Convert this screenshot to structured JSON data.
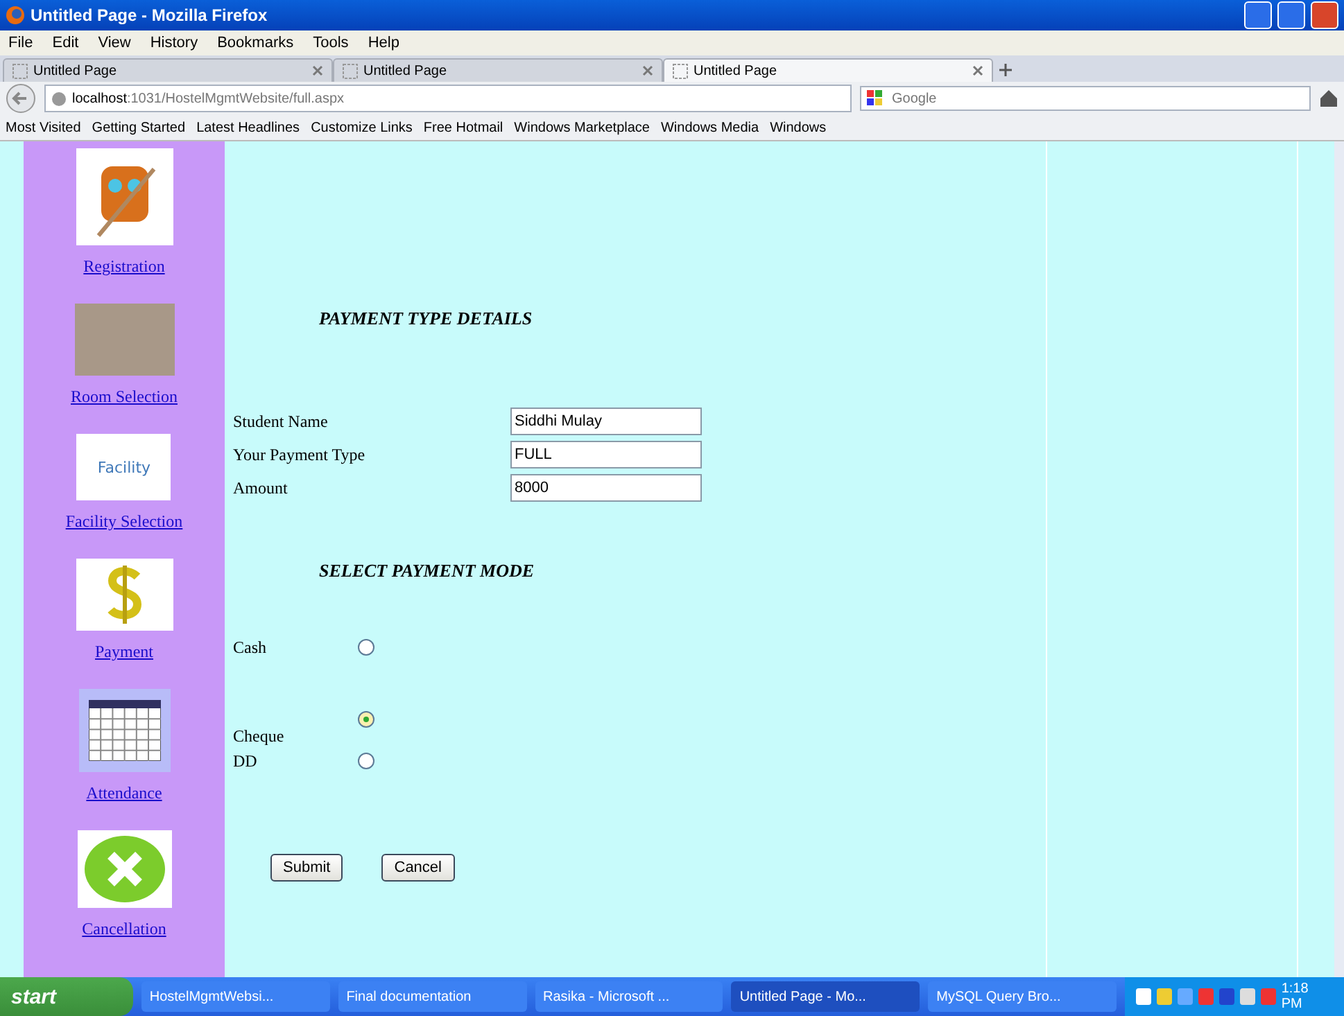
{
  "window": {
    "title": "Untitled Page - Mozilla Firefox"
  },
  "menu": [
    "File",
    "Edit",
    "View",
    "History",
    "Bookmarks",
    "Tools",
    "Help"
  ],
  "tabs": [
    {
      "label": "Untitled Page",
      "selected": false
    },
    {
      "label": "Untitled Page",
      "selected": false
    },
    {
      "label": "Untitled Page",
      "selected": true
    }
  ],
  "address": {
    "host": "localhost",
    "path": ":1031/HostelMgmtWebsite/full.aspx"
  },
  "search": {
    "placeholder": "Google"
  },
  "bookmarks": [
    "Most Visited",
    "Getting Started",
    "Latest Headlines",
    "Customize Links",
    "Free Hotmail",
    "Windows Marketplace",
    "Windows Media",
    "Windows"
  ],
  "sidebar": {
    "items": [
      {
        "label": "Registration",
        "kind": "owl"
      },
      {
        "label": "Room Selection",
        "kind": "photo"
      },
      {
        "label": "Facility Selection",
        "kind": "logo",
        "logo_text": "Facility"
      },
      {
        "label": "Payment",
        "kind": "dollar"
      },
      {
        "label": "Attendance",
        "kind": "calendar"
      },
      {
        "label": "Cancellation",
        "kind": "cancel"
      }
    ]
  },
  "details": {
    "heading": "PAYMENT TYPE DETAILS",
    "fields": [
      {
        "label": "Student Name",
        "value": "Siddhi Mulay"
      },
      {
        "label": "Your Payment Type",
        "value": "FULL"
      },
      {
        "label": "Amount",
        "value": "8000"
      }
    ]
  },
  "mode": {
    "heading": "SELECT PAYMENT MODE",
    "options": [
      {
        "label": "Cash",
        "selected": false
      },
      {
        "label": "Cheque",
        "selected": true
      },
      {
        "label": "DD",
        "selected": false
      }
    ]
  },
  "buttons": [
    "Submit",
    "Cancel"
  ],
  "taskbar": {
    "start": "start",
    "items": [
      {
        "label": "HostelMgmtWebsi...",
        "selected": false
      },
      {
        "label": "Final documentation",
        "selected": false
      },
      {
        "label": "Rasika - Microsoft ...",
        "selected": false
      },
      {
        "label": "Untitled Page - Mo...",
        "selected": true
      },
      {
        "label": "MySQL Query Bro...",
        "selected": false
      }
    ],
    "clock": "1:18 PM"
  }
}
